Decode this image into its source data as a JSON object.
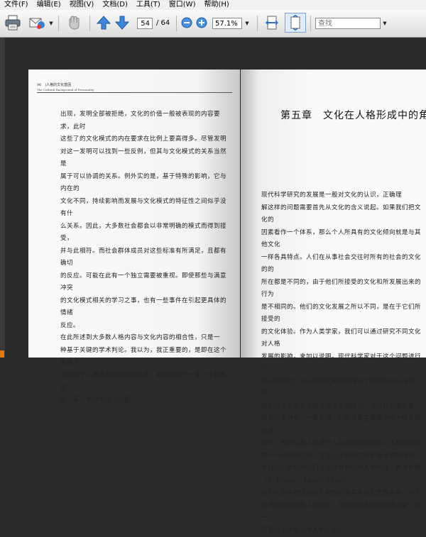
{
  "menubar": {
    "items": [
      "文件(F)",
      "编辑(E)",
      "视图(V)",
      "文档(D)",
      "工具(T)",
      "窗口(W)",
      "帮助(H)"
    ]
  },
  "toolbar": {
    "page_current": "54",
    "page_total": "/ 64",
    "zoom": "57.1%",
    "search_placeholder": "查找",
    "icons": [
      "print-icon",
      "email-icon",
      "hand-tool-icon",
      "prev-page-icon",
      "next-page-icon",
      "zoom-out-icon",
      "zoom-in-icon",
      "fit-width-icon",
      "fit-page-icon"
    ]
  },
  "document": {
    "left_page": {
      "page_number": "96",
      "header_title": "人格的文化基因",
      "header_subtitle": "The Cultural Background of Personality",
      "body": "出现，发明全部被拒绝，文化的价值一般被表现的内容要求，此时\n这些了的文化模式的内在要求在比例上要高得多。尽管发明\n对这一发明可以找到一些反例，但其与文化模式的关系当然是\n属于可以协调的关系。例外实的是，基于特殊的影响，它与内在的\n文化不同，持续影响而发展与文化模式的特征性之间似乎没有什\n么关系。因此，大多数社会都会以非常明确的模式而得到接受，\n并与此相符。而社会群体成员对这些标准有所满足，且都有确切\n的反应。可能在此有一个独立需要被重视。即使那些与满意冲突\n的文化模式相关的学习之事，也有一些事件在引起更具体的情绪\n反应。\n    在此所述到大多数人格内容与文化内容的相合性，只是一\n种基于关键的学术判论。我以为，我正重要的，是即在这个发展了\n文化对于人格发展影响的相关性。我们将在下一章，也就是在\n后一章，来讨论这一问题。"
    },
    "right_page": {
      "chapter_title": "第五章　文化在人格形成中的角色",
      "body": "    现代科学研究的发展是一般对文化的认识，正确理\n解这样的问题需要首先从文化的含义说起。如果我们把文化的\n因素看作一个体系，那么个人所具有的文化倾向就是与其他文化\n一样各具特点。人们在从事社会交往时所有的社会的文化的的\n所在都是不同的，由于他们所接受的文化和所发展出来的行为\n是不相同的。他们的文化发展之所以不同，是在于它们所接受的\n的文化体验。作为人类学家，我们可以通过研究不同文化对人格\n发展的影响，来加以说明。现代科学家对于这个问题进行了\n深入的研究，对于这种文化影响做出了系统的分析与说明。\n    目前对于文化与人格之间关系的研究，可以从心理学家\n的观点来分析。一般来说，心理学家主要集中在个体发展的过\n程中，他们认为人格是个人在发展中形成的。人格的形成\n是一个持续的过程，在这一过程中文化起着关键的作用，\n来自同一文化的人们往往具有相似的人格特征。弗洛伊德（S. Freud，1856—1939）\n认为人的早期经验对人格的形成具有决定性的影响，对于\n在早期所形成的人格特点，在以后的发展中很难改变，在一\n定程度上决定了个人的一生。"
    }
  }
}
